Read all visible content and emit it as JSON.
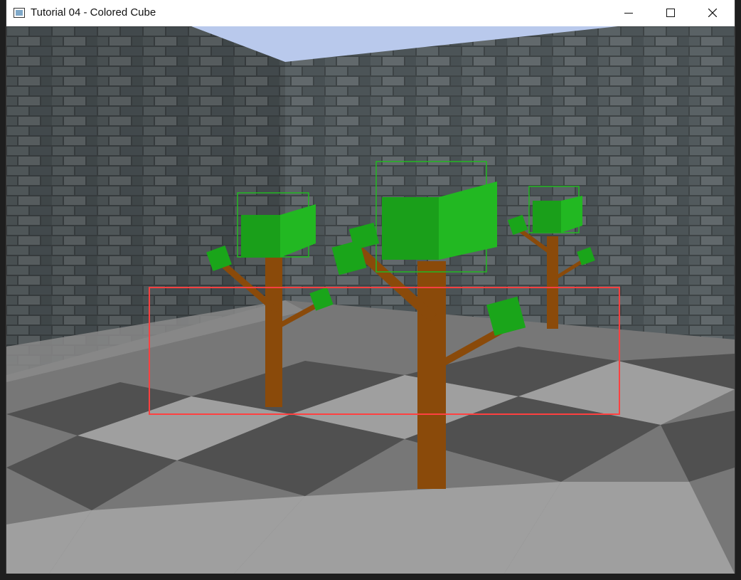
{
  "window": {
    "title": "Tutorial 04 - Colored Cube",
    "icon": "app-window-icon",
    "controls": [
      "minimize-icon",
      "maximize-icon",
      "close-icon"
    ]
  },
  "scene": {
    "sky_color": "#b9c9ec",
    "wall_color": "#3e4446",
    "floor_light": "#9a9a9a",
    "floor_dark": "#4a4a4a",
    "trunk_color": "#8a4a0a",
    "leaf_color": "#22b822",
    "highlight_box_color": "#ff4040"
  }
}
